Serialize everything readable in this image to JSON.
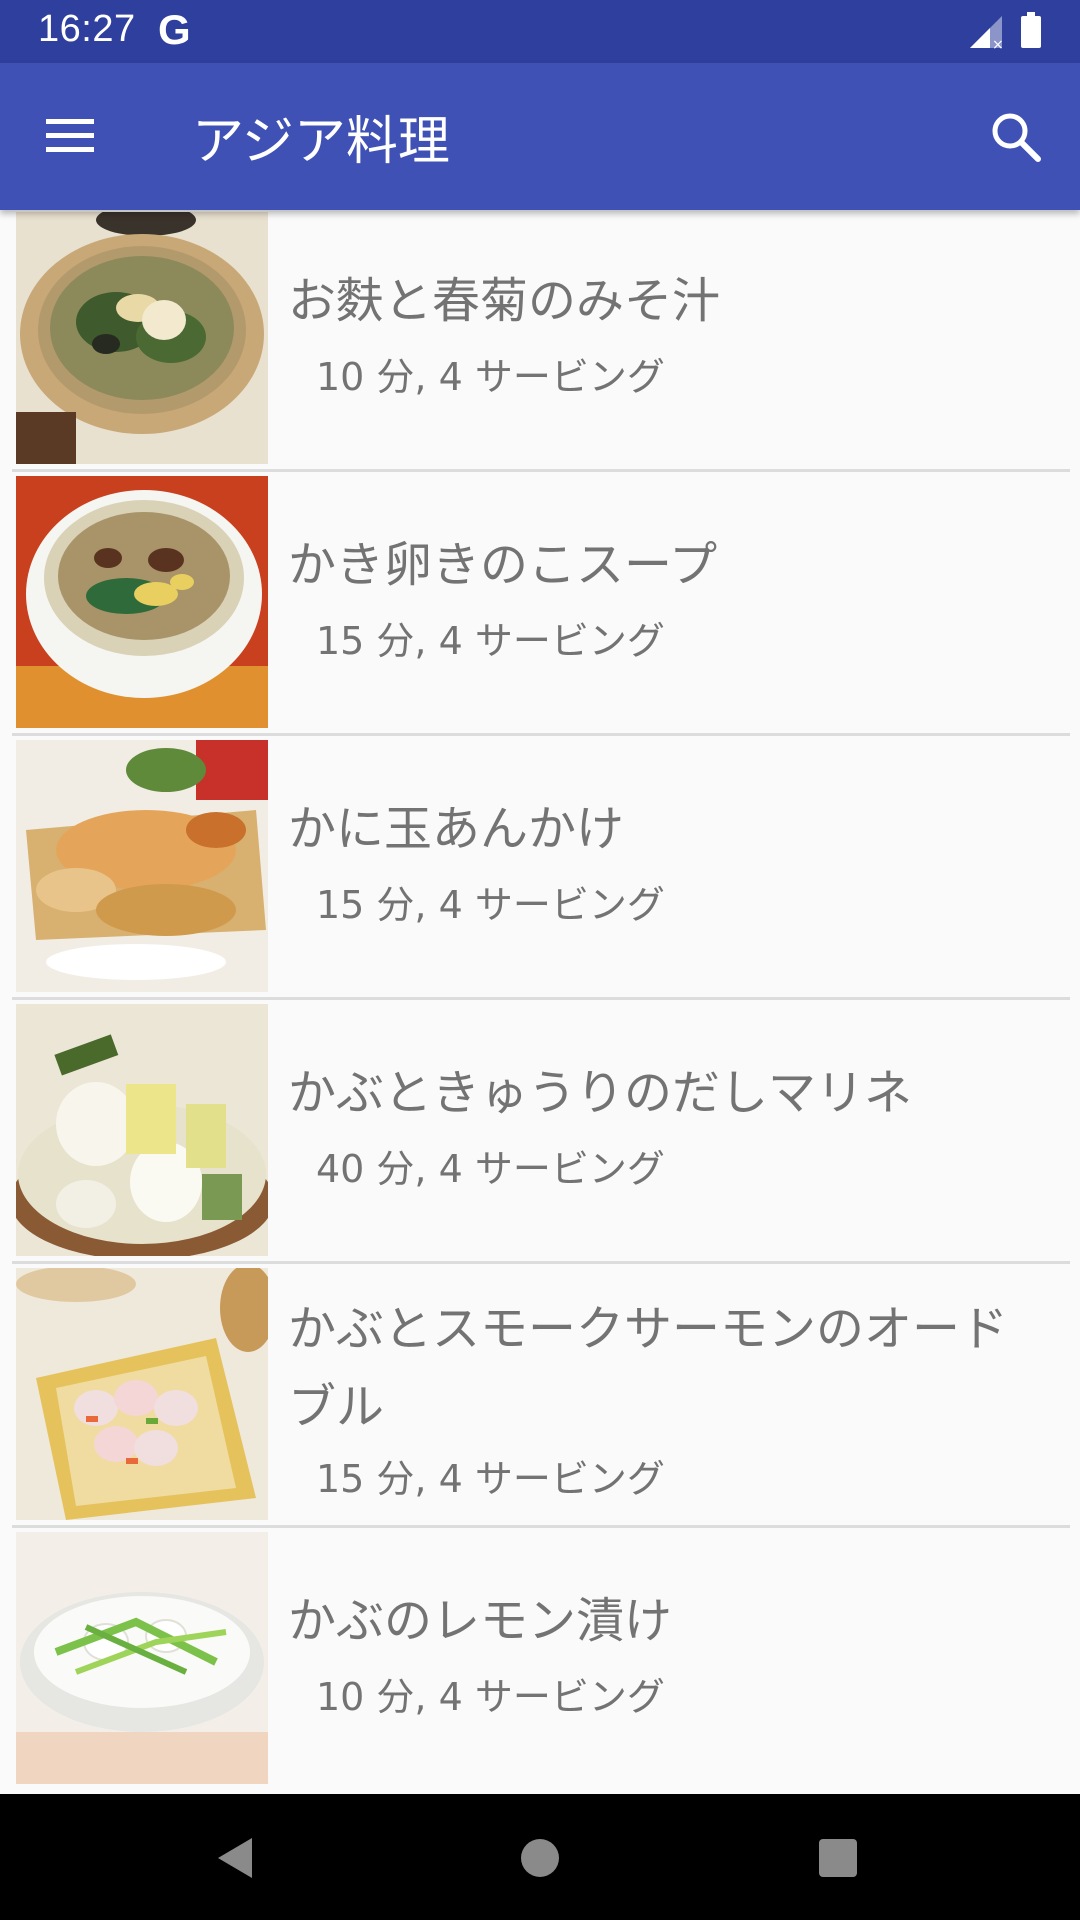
{
  "status_bar": {
    "time": "16:27",
    "google_glyph": "G",
    "icons": [
      "signal-icon",
      "battery-icon"
    ]
  },
  "app_bar": {
    "title": "アジア料理",
    "color": "#3f51b5",
    "icons": [
      "menu-icon",
      "search-icon"
    ]
  },
  "recipes": [
    {
      "title": "お麩と春菊のみそ汁",
      "meta": "10 分, 4 サービング"
    },
    {
      "title": "かき卵きのこスープ",
      "meta": "15 分, 4 サービング"
    },
    {
      "title": "かに玉あんかけ",
      "meta": "15 分, 4 サービング"
    },
    {
      "title": "かぶときゅうりのだしマリネ",
      "meta": "40 分, 4 サービング"
    },
    {
      "title": "かぶとスモークサーモンのオードブル",
      "meta": "15 分, 4 サービング"
    },
    {
      "title": "かぶのレモン漬け",
      "meta": "10 分, 4 サービング"
    }
  ],
  "nav_bar": {
    "icons": [
      "back-icon",
      "home-icon",
      "recents-icon"
    ]
  }
}
